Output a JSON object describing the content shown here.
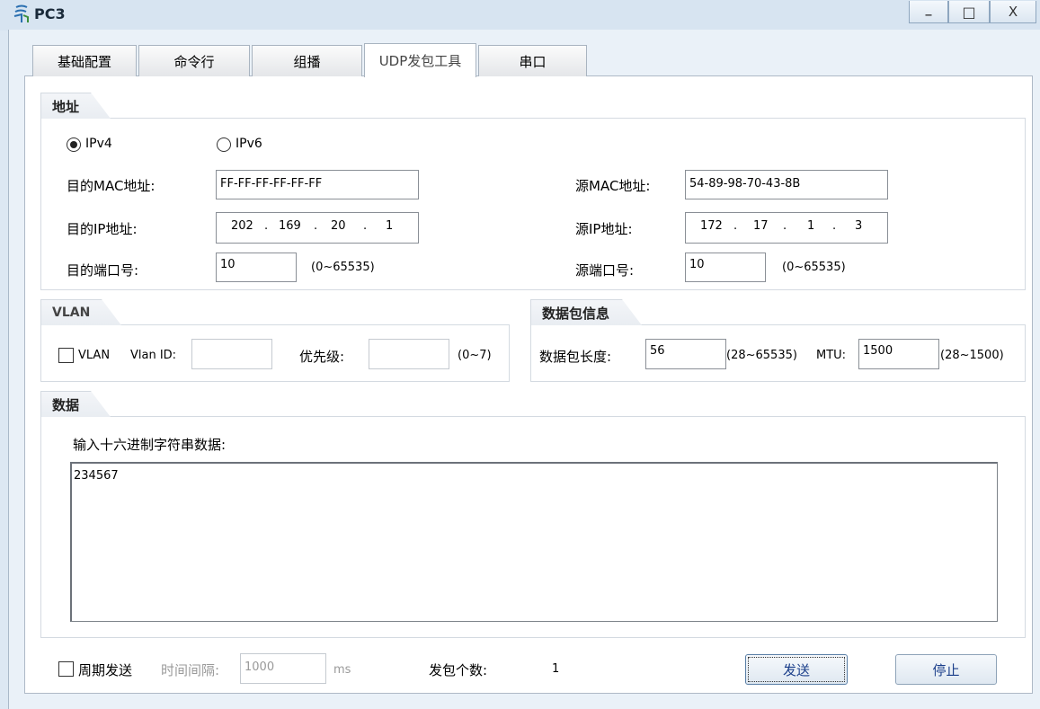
{
  "window": {
    "title": "PC3",
    "controls": {
      "minimize": "_",
      "maximize": "□",
      "close": "X"
    }
  },
  "tabs": [
    {
      "label": "基础配置",
      "active": false
    },
    {
      "label": "命令行",
      "active": false
    },
    {
      "label": "组播",
      "active": false
    },
    {
      "label": "UDP发包工具",
      "active": true
    },
    {
      "label": "串口",
      "active": false
    }
  ],
  "address": {
    "title": "地址",
    "ipv4_label": "IPv4",
    "ipv6_label": "IPv6",
    "selected": "IPv4",
    "dst_mac_label": "目的MAC地址:",
    "dst_mac": "FF-FF-FF-FF-FF-FF",
    "src_mac_label": "源MAC地址:",
    "src_mac": "54-89-98-70-43-8B",
    "dst_ip_label": "目的IP地址:",
    "dst_ip": [
      "202",
      "169",
      "20",
      "1"
    ],
    "src_ip_label": "源IP地址:",
    "src_ip": [
      "172",
      "17",
      "1",
      "3"
    ],
    "ip_sep": ".",
    "dst_port_label": "目的端口号:",
    "dst_port": "10",
    "dst_port_range": "(0~65535)",
    "src_port_label": "源端口号:",
    "src_port": "10",
    "src_port_range": "(0~65535)"
  },
  "vlan": {
    "title": "VLAN",
    "checkbox_label": "VLAN",
    "checked": false,
    "vlan_id_label": "Vlan ID:",
    "vlan_id": "",
    "priority_label": "优先级:",
    "priority": "",
    "priority_range": "(0~7)"
  },
  "packet": {
    "title": "数据包信息",
    "length_label": "数据包长度:",
    "length": "56",
    "length_range": "(28~65535)",
    "mtu_label": "MTU:",
    "mtu": "1500",
    "mtu_range": "(28~1500)"
  },
  "data": {
    "title": "数据",
    "hex_label": "输入十六进制字符串数据:",
    "content": "234567"
  },
  "footer": {
    "periodic_label": "周期发送",
    "periodic_checked": false,
    "interval_label": "时间间隔:",
    "interval": "1000",
    "interval_unit": "ms",
    "count_label": "发包个数:",
    "count": "1",
    "send_label": "发送",
    "stop_label": "停止"
  }
}
